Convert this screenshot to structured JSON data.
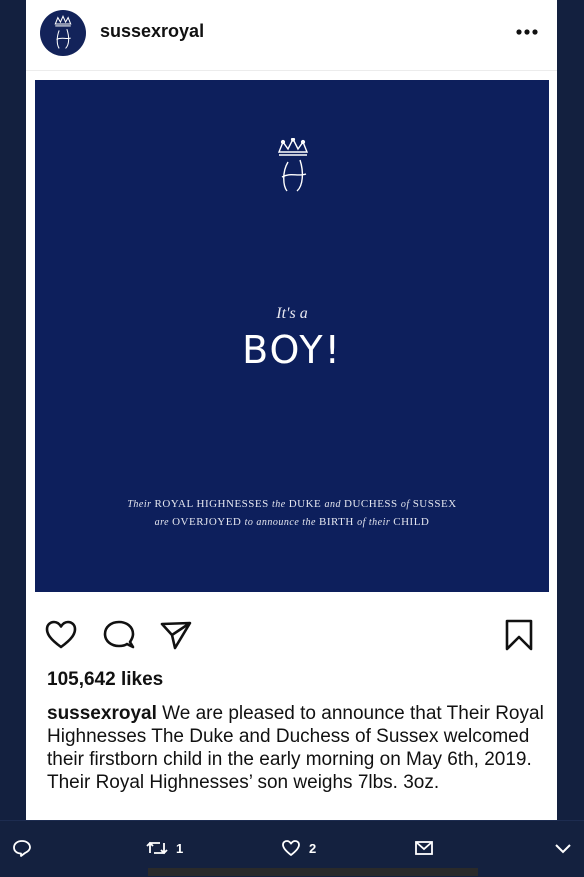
{
  "post": {
    "username": "sussexroyal",
    "image": {
      "its_a": "It's a",
      "headline": "BOY!",
      "line1": [
        {
          "t": "Their ",
          "i": true
        },
        {
          "t": "ROYAL HIGHNESSES ",
          "i": false
        },
        {
          "t": "the ",
          "i": true
        },
        {
          "t": "DUKE ",
          "i": false
        },
        {
          "t": "and ",
          "i": true
        },
        {
          "t": "DUCHESS ",
          "i": false
        },
        {
          "t": "of ",
          "i": true
        },
        {
          "t": "SUSSEX",
          "i": false
        }
      ],
      "line2": [
        {
          "t": "are ",
          "i": true
        },
        {
          "t": "OVERJOYED ",
          "i": false
        },
        {
          "t": "to announce the ",
          "i": true
        },
        {
          "t": "BIRTH ",
          "i": false
        },
        {
          "t": "of their ",
          "i": true
        },
        {
          "t": "CHILD",
          "i": false
        }
      ]
    },
    "likes": "105,642 likes",
    "caption_user": "sussexroyal",
    "caption_text": " We are pleased to announce that Their Royal Highnesses The Duke and Duchess of Sussex welcomed their firstborn child in the early morning on May 6th, 2019. Their Royal Highnesses’ son weighs 7lbs. 3oz."
  },
  "bottom_bar": {
    "retweet_count": "1",
    "like_count": "2"
  },
  "colors": {
    "background": "#13203f",
    "post_navy": "#0d1f5c",
    "avatar_navy": "#13235a"
  },
  "icons": [
    "monogram-icon",
    "more-icon",
    "heart-icon",
    "comment-icon",
    "share-icon",
    "bookmark-icon",
    "reply-icon",
    "retweet-icon",
    "like-icon",
    "mail-icon",
    "chevron-down-icon"
  ]
}
